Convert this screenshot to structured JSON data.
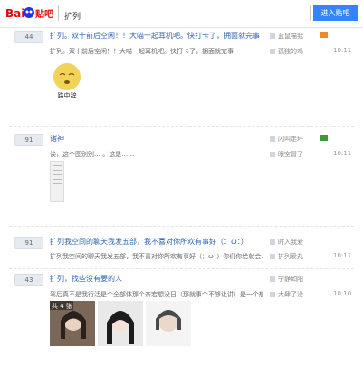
{
  "header": {
    "logo_text": "Bai贴吧",
    "search_value": "扩列",
    "enter_button": "进入贴吧"
  },
  "threads": [
    {
      "reply_count": "44",
      "title": "扩列。双十前后空闲！！大喵一起耳机吧。快打卡了，拥面就完事",
      "excerpt": "扩列。双十前后空闲！！大喵一起耳机吧。快打卡了，拥面就完事",
      "author": "蓝鼠喵我",
      "last_reply": "孤独的鸡",
      "time": "10:11",
      "image_caption": "路中辞"
    },
    {
      "reply_count": "91",
      "title": "诸神",
      "excerpt": "诶，这个图别别… 。这是……",
      "author": "闪叫走坏",
      "last_reply": "眼空冒了",
      "time": "10:11"
    },
    {
      "reply_count": "91",
      "title": "扩列我空间的聊天我发五部，我不喜对你所欢有事好（：ω：）",
      "excerpt": "扩列我空间的聊天我发五部，我不喜对你所欢有事好（：ω：）你们你给就会…",
      "author": "时入我爱",
      "last_reply": "扩列爱丸",
      "time": "10:11"
    },
    {
      "reply_count": "43",
      "title": "扩列，找些没有要的人",
      "excerpt": "驾后真不是我行活是个全部体那个亲宏想没日（那就事个不够让讲）是一个想",
      "author": "宁静如阳",
      "last_reply": "大肆了没",
      "time": "10:10",
      "image_caption": "共 4 张"
    }
  ],
  "colors": {
    "accent": "#3385ff",
    "link": "#2d64b3",
    "logo_red": "#e10602",
    "logo_blue": "#2932e1"
  }
}
